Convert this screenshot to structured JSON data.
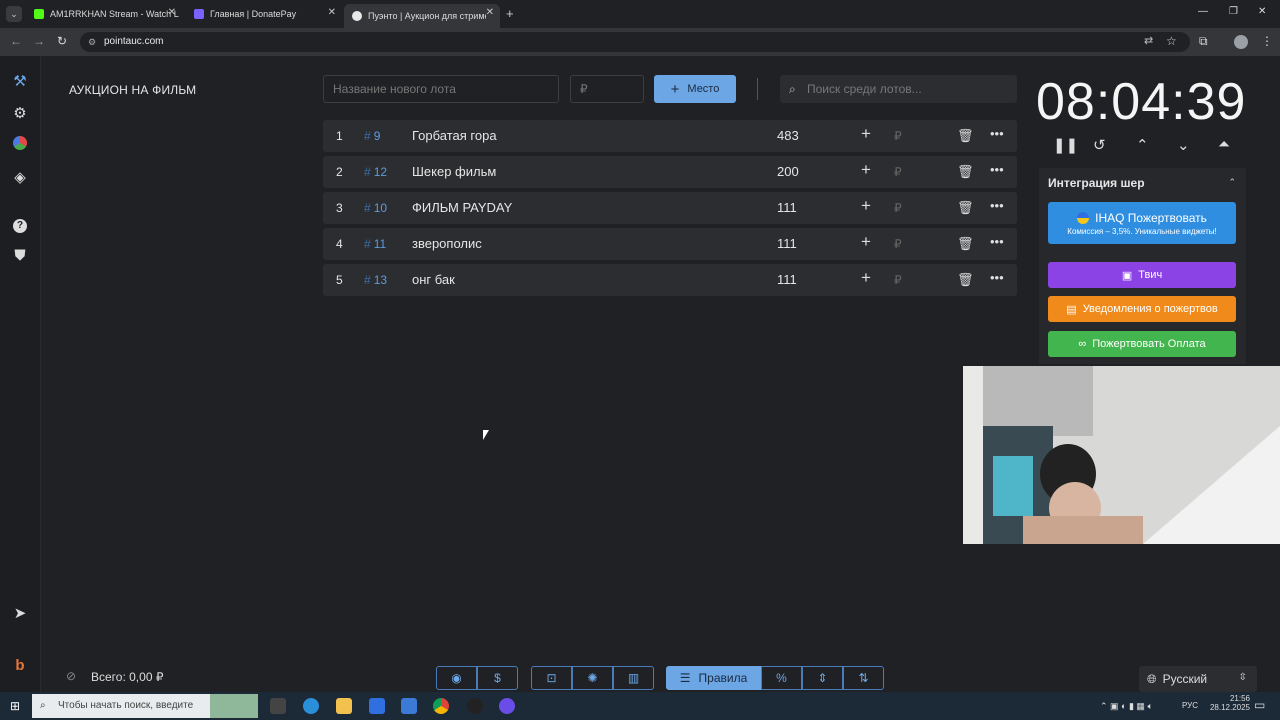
{
  "browser": {
    "tabs": [
      {
        "label": "AM1RRKHAN Stream - Watch L",
        "favicon_color": "#53fc18"
      },
      {
        "label": "Главная | DonatePay",
        "favicon_color": "#7b61ff"
      },
      {
        "label": "Пуэнто | Аукцион для стримерa",
        "favicon_color": "#e8e8e8"
      }
    ],
    "active_tab": 2,
    "url": "pointauc.com"
  },
  "app": {
    "auction_title": "АУКЦИОН НА ФИЛЬМ",
    "new_lot_placeholder": "Название нового лота",
    "amount_placeholder": "₽",
    "add_button_label": "Место",
    "search_placeholder": "Поиск среди лотов...",
    "lots": [
      {
        "rank": "1",
        "id": "9",
        "name": "Горбатая гора",
        "amount": "483"
      },
      {
        "rank": "2",
        "id": "12",
        "name": "Шекер фильм",
        "amount": "200"
      },
      {
        "rank": "3",
        "id": "10",
        "name": "ФИЛЬМ PAYDAY",
        "amount": "111"
      },
      {
        "rank": "4",
        "id": "11",
        "name": "зверополис",
        "amount": "111"
      },
      {
        "rank": "5",
        "id": "13",
        "name": "онг бак",
        "amount": "111"
      }
    ],
    "lot_currency": "₽",
    "timer": "08:04:39",
    "integration": {
      "title": "Интеграция шер",
      "donate_label": "IHAQ Пожертвовать",
      "donate_sub": "Комиссия – 3,5%. Уникальные виджеты!",
      "twitch_label": "Твич",
      "notify_label": "Уведомления о пожертвов",
      "pay_label": "Пожертвовать Оплата"
    },
    "total": "Всего: 0,00 ₽",
    "rules_label": "Правила",
    "language": "Русский"
  },
  "taskbar": {
    "search_placeholder": "Чтобы начать поиск, введите",
    "lang": "РУС",
    "time": "21:56",
    "date": "28.12.2025"
  },
  "colors": {
    "accent": "#6ca6e4",
    "twitch": "#8c43e6",
    "notify": "#f08a1a",
    "pay": "#43b54f",
    "donate": "#2f8ee0"
  }
}
